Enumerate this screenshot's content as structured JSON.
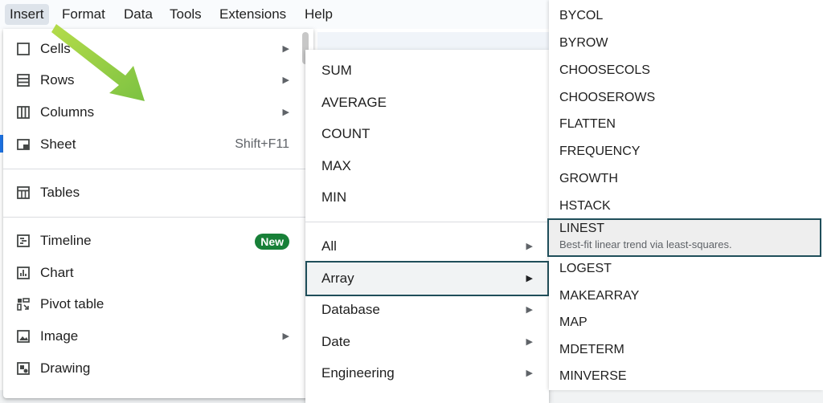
{
  "menubar": {
    "items": [
      {
        "label": "Insert",
        "active": true
      },
      {
        "label": "Format"
      },
      {
        "label": "Data"
      },
      {
        "label": "Tools"
      },
      {
        "label": "Extensions"
      },
      {
        "label": "Help"
      }
    ]
  },
  "insert_menu": {
    "items": [
      {
        "label": "Cells",
        "icon": "cell-icon",
        "submenu": true
      },
      {
        "label": "Rows",
        "icon": "rows-icon",
        "submenu": true
      },
      {
        "label": "Columns",
        "icon": "columns-icon",
        "submenu": true
      },
      {
        "label": "Sheet",
        "icon": "sheet-icon",
        "shortcut": "Shift+F11"
      },
      {
        "label": "Tables",
        "icon": "table-icon"
      },
      {
        "label": "Timeline",
        "icon": "timeline-icon",
        "badge": "New"
      },
      {
        "label": "Chart",
        "icon": "chart-icon"
      },
      {
        "label": "Pivot table",
        "icon": "pivot-table-icon"
      },
      {
        "label": "Image",
        "icon": "image-icon",
        "submenu": true
      },
      {
        "label": "Drawing",
        "icon": "drawing-icon"
      }
    ]
  },
  "function_menu": {
    "items": [
      {
        "label": "SUM"
      },
      {
        "label": "AVERAGE"
      },
      {
        "label": "COUNT"
      },
      {
        "label": "MAX"
      },
      {
        "label": "MIN"
      },
      {
        "label": "All",
        "submenu": true
      },
      {
        "label": "Array",
        "submenu": true,
        "highlighted": true
      },
      {
        "label": "Database",
        "submenu": true
      },
      {
        "label": "Date",
        "submenu": true
      },
      {
        "label": "Engineering",
        "submenu": true
      }
    ]
  },
  "array_menu": {
    "items": [
      {
        "label": "BYCOL"
      },
      {
        "label": "BYROW"
      },
      {
        "label": "CHOOSECOLS"
      },
      {
        "label": "CHOOSEROWS"
      },
      {
        "label": "FLATTEN"
      },
      {
        "label": "FREQUENCY"
      },
      {
        "label": "GROWTH"
      },
      {
        "label": "HSTACK"
      },
      {
        "label": "LINEST",
        "highlighted": true,
        "description": "Best-fit linear trend via least-squares."
      },
      {
        "label": "LOGEST"
      },
      {
        "label": "MAKEARRAY"
      },
      {
        "label": "MAP"
      },
      {
        "label": "MDETERM"
      },
      {
        "label": "MINVERSE"
      }
    ]
  },
  "colors": {
    "accent": "#188038",
    "highlight_border": "#1f4e5a",
    "annotation_arrow": "#8bc34a"
  }
}
